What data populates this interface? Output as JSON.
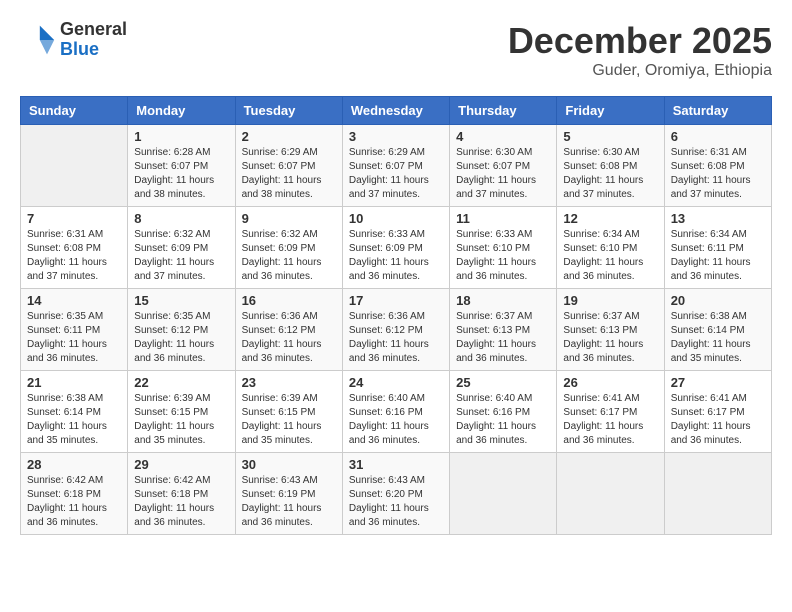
{
  "logo": {
    "general": "General",
    "blue": "Blue"
  },
  "title": "December 2025",
  "location": "Guder, Oromiya, Ethiopia",
  "weekdays": [
    "Sunday",
    "Monday",
    "Tuesday",
    "Wednesday",
    "Thursday",
    "Friday",
    "Saturday"
  ],
  "weeks": [
    [
      {
        "day": null,
        "sunrise": null,
        "sunset": null,
        "daylight": null
      },
      {
        "day": "1",
        "sunrise": "Sunrise: 6:28 AM",
        "sunset": "Sunset: 6:07 PM",
        "daylight": "Daylight: 11 hours and 38 minutes."
      },
      {
        "day": "2",
        "sunrise": "Sunrise: 6:29 AM",
        "sunset": "Sunset: 6:07 PM",
        "daylight": "Daylight: 11 hours and 38 minutes."
      },
      {
        "day": "3",
        "sunrise": "Sunrise: 6:29 AM",
        "sunset": "Sunset: 6:07 PM",
        "daylight": "Daylight: 11 hours and 37 minutes."
      },
      {
        "day": "4",
        "sunrise": "Sunrise: 6:30 AM",
        "sunset": "Sunset: 6:07 PM",
        "daylight": "Daylight: 11 hours and 37 minutes."
      },
      {
        "day": "5",
        "sunrise": "Sunrise: 6:30 AM",
        "sunset": "Sunset: 6:08 PM",
        "daylight": "Daylight: 11 hours and 37 minutes."
      },
      {
        "day": "6",
        "sunrise": "Sunrise: 6:31 AM",
        "sunset": "Sunset: 6:08 PM",
        "daylight": "Daylight: 11 hours and 37 minutes."
      }
    ],
    [
      {
        "day": "7",
        "sunrise": "Sunrise: 6:31 AM",
        "sunset": "Sunset: 6:08 PM",
        "daylight": "Daylight: 11 hours and 37 minutes."
      },
      {
        "day": "8",
        "sunrise": "Sunrise: 6:32 AM",
        "sunset": "Sunset: 6:09 PM",
        "daylight": "Daylight: 11 hours and 37 minutes."
      },
      {
        "day": "9",
        "sunrise": "Sunrise: 6:32 AM",
        "sunset": "Sunset: 6:09 PM",
        "daylight": "Daylight: 11 hours and 36 minutes."
      },
      {
        "day": "10",
        "sunrise": "Sunrise: 6:33 AM",
        "sunset": "Sunset: 6:09 PM",
        "daylight": "Daylight: 11 hours and 36 minutes."
      },
      {
        "day": "11",
        "sunrise": "Sunrise: 6:33 AM",
        "sunset": "Sunset: 6:10 PM",
        "daylight": "Daylight: 11 hours and 36 minutes."
      },
      {
        "day": "12",
        "sunrise": "Sunrise: 6:34 AM",
        "sunset": "Sunset: 6:10 PM",
        "daylight": "Daylight: 11 hours and 36 minutes."
      },
      {
        "day": "13",
        "sunrise": "Sunrise: 6:34 AM",
        "sunset": "Sunset: 6:11 PM",
        "daylight": "Daylight: 11 hours and 36 minutes."
      }
    ],
    [
      {
        "day": "14",
        "sunrise": "Sunrise: 6:35 AM",
        "sunset": "Sunset: 6:11 PM",
        "daylight": "Daylight: 11 hours and 36 minutes."
      },
      {
        "day": "15",
        "sunrise": "Sunrise: 6:35 AM",
        "sunset": "Sunset: 6:12 PM",
        "daylight": "Daylight: 11 hours and 36 minutes."
      },
      {
        "day": "16",
        "sunrise": "Sunrise: 6:36 AM",
        "sunset": "Sunset: 6:12 PM",
        "daylight": "Daylight: 11 hours and 36 minutes."
      },
      {
        "day": "17",
        "sunrise": "Sunrise: 6:36 AM",
        "sunset": "Sunset: 6:12 PM",
        "daylight": "Daylight: 11 hours and 36 minutes."
      },
      {
        "day": "18",
        "sunrise": "Sunrise: 6:37 AM",
        "sunset": "Sunset: 6:13 PM",
        "daylight": "Daylight: 11 hours and 36 minutes."
      },
      {
        "day": "19",
        "sunrise": "Sunrise: 6:37 AM",
        "sunset": "Sunset: 6:13 PM",
        "daylight": "Daylight: 11 hours and 36 minutes."
      },
      {
        "day": "20",
        "sunrise": "Sunrise: 6:38 AM",
        "sunset": "Sunset: 6:14 PM",
        "daylight": "Daylight: 11 hours and 35 minutes."
      }
    ],
    [
      {
        "day": "21",
        "sunrise": "Sunrise: 6:38 AM",
        "sunset": "Sunset: 6:14 PM",
        "daylight": "Daylight: 11 hours and 35 minutes."
      },
      {
        "day": "22",
        "sunrise": "Sunrise: 6:39 AM",
        "sunset": "Sunset: 6:15 PM",
        "daylight": "Daylight: 11 hours and 35 minutes."
      },
      {
        "day": "23",
        "sunrise": "Sunrise: 6:39 AM",
        "sunset": "Sunset: 6:15 PM",
        "daylight": "Daylight: 11 hours and 35 minutes."
      },
      {
        "day": "24",
        "sunrise": "Sunrise: 6:40 AM",
        "sunset": "Sunset: 6:16 PM",
        "daylight": "Daylight: 11 hours and 36 minutes."
      },
      {
        "day": "25",
        "sunrise": "Sunrise: 6:40 AM",
        "sunset": "Sunset: 6:16 PM",
        "daylight": "Daylight: 11 hours and 36 minutes."
      },
      {
        "day": "26",
        "sunrise": "Sunrise: 6:41 AM",
        "sunset": "Sunset: 6:17 PM",
        "daylight": "Daylight: 11 hours and 36 minutes."
      },
      {
        "day": "27",
        "sunrise": "Sunrise: 6:41 AM",
        "sunset": "Sunset: 6:17 PM",
        "daylight": "Daylight: 11 hours and 36 minutes."
      }
    ],
    [
      {
        "day": "28",
        "sunrise": "Sunrise: 6:42 AM",
        "sunset": "Sunset: 6:18 PM",
        "daylight": "Daylight: 11 hours and 36 minutes."
      },
      {
        "day": "29",
        "sunrise": "Sunrise: 6:42 AM",
        "sunset": "Sunset: 6:18 PM",
        "daylight": "Daylight: 11 hours and 36 minutes."
      },
      {
        "day": "30",
        "sunrise": "Sunrise: 6:43 AM",
        "sunset": "Sunset: 6:19 PM",
        "daylight": "Daylight: 11 hours and 36 minutes."
      },
      {
        "day": "31",
        "sunrise": "Sunrise: 6:43 AM",
        "sunset": "Sunset: 6:20 PM",
        "daylight": "Daylight: 11 hours and 36 minutes."
      },
      {
        "day": null,
        "sunrise": null,
        "sunset": null,
        "daylight": null
      },
      {
        "day": null,
        "sunrise": null,
        "sunset": null,
        "daylight": null
      },
      {
        "day": null,
        "sunrise": null,
        "sunset": null,
        "daylight": null
      }
    ]
  ]
}
